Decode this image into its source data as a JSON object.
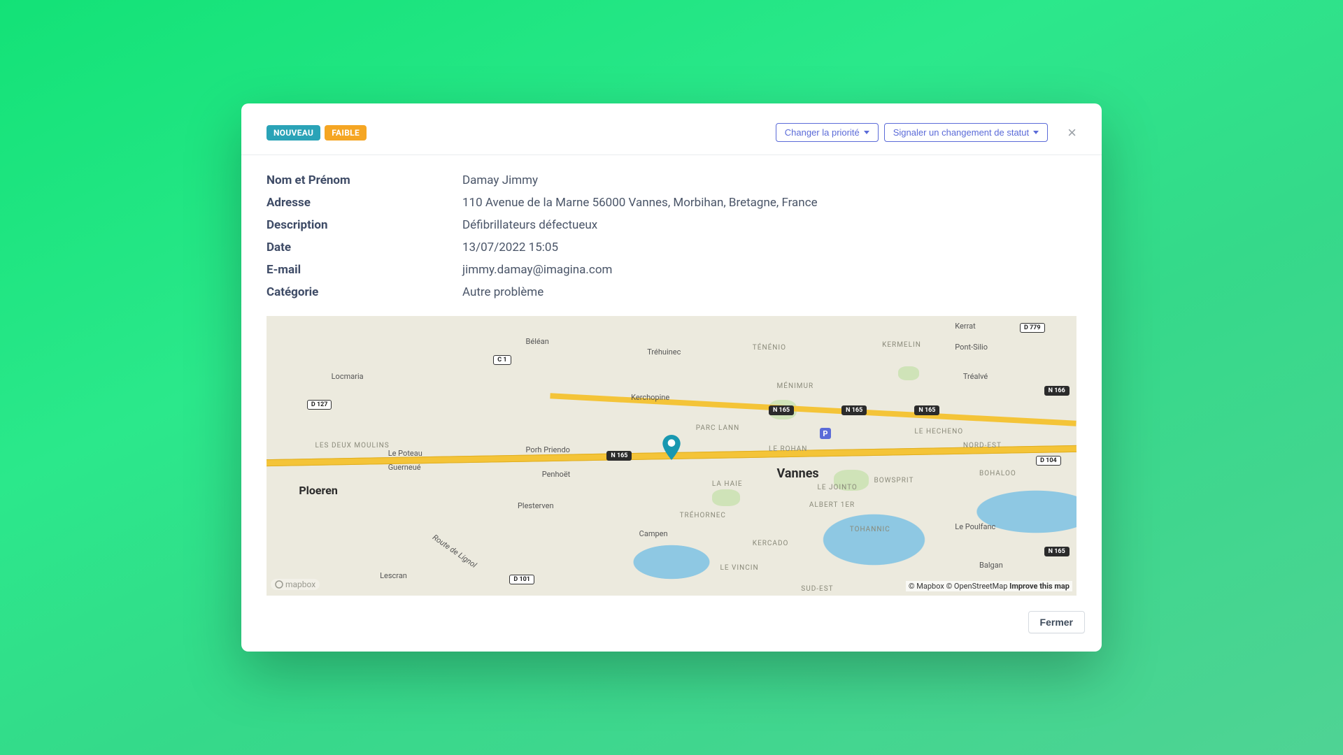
{
  "badges": {
    "status": "NOUVEAU",
    "priority": "FAIBLE"
  },
  "actions": {
    "change_priority": "Changer la priorité",
    "change_status": "Signaler un changement de statut"
  },
  "fields": {
    "name_label": "Nom et Prénom",
    "name_value": "Damay Jimmy",
    "address_label": "Adresse",
    "address_value": "110 Avenue de la Marne 56000 Vannes, Morbihan, Bretagne, France",
    "description_label": "Description",
    "description_value": "Défibrillateurs défectueux",
    "date_label": "Date",
    "date_value": "13/07/2022 15:05",
    "email_label": "E-mail",
    "email_value": "jimmy.damay@imagina.com",
    "category_label": "Catégorie",
    "category_value": "Autre problème"
  },
  "map": {
    "city_main": "Vannes",
    "city_secondary": "Ploeren",
    "towns": [
      "Béléan",
      "Tréhuinec",
      "Kerchopine",
      "Porh Priendo",
      "Penhoët",
      "Plesterven",
      "Campen",
      "Lescran",
      "Locmaria",
      "Le Poteau",
      "Guerneué",
      "Kerrat",
      "Pont-Silio",
      "Tréalvé",
      "Le Poulfanc",
      "Balgan"
    ],
    "districts": [
      "TÉNÉNIO",
      "MÉNIMUR",
      "PARC LANN",
      "LE ROHAN",
      "LA HAIE",
      "TRÉHORNEC",
      "KERCADO",
      "LE VINCIN",
      "ALBERT 1ER",
      "TOHANNIC",
      "LE JOINTO",
      "BOWSPRIT",
      "NORD-EST",
      "LE HECHENO",
      "BOHALOO",
      "KERMELIN",
      "LES DEUX MOULINS",
      "SUD-EST"
    ],
    "roads": [
      "N 165",
      "D 127",
      "C 1",
      "D 101",
      "D 104",
      "D 779",
      "N 165",
      "N 165",
      "N 165",
      "N 165",
      "N 166"
    ],
    "river": "Route de Lignol",
    "attribution": {
      "mapbox": "© Mapbox",
      "osm": "© OpenStreetMap",
      "improve": "Improve this map",
      "logo": "mapbox"
    }
  },
  "footer": {
    "close": "Fermer"
  }
}
